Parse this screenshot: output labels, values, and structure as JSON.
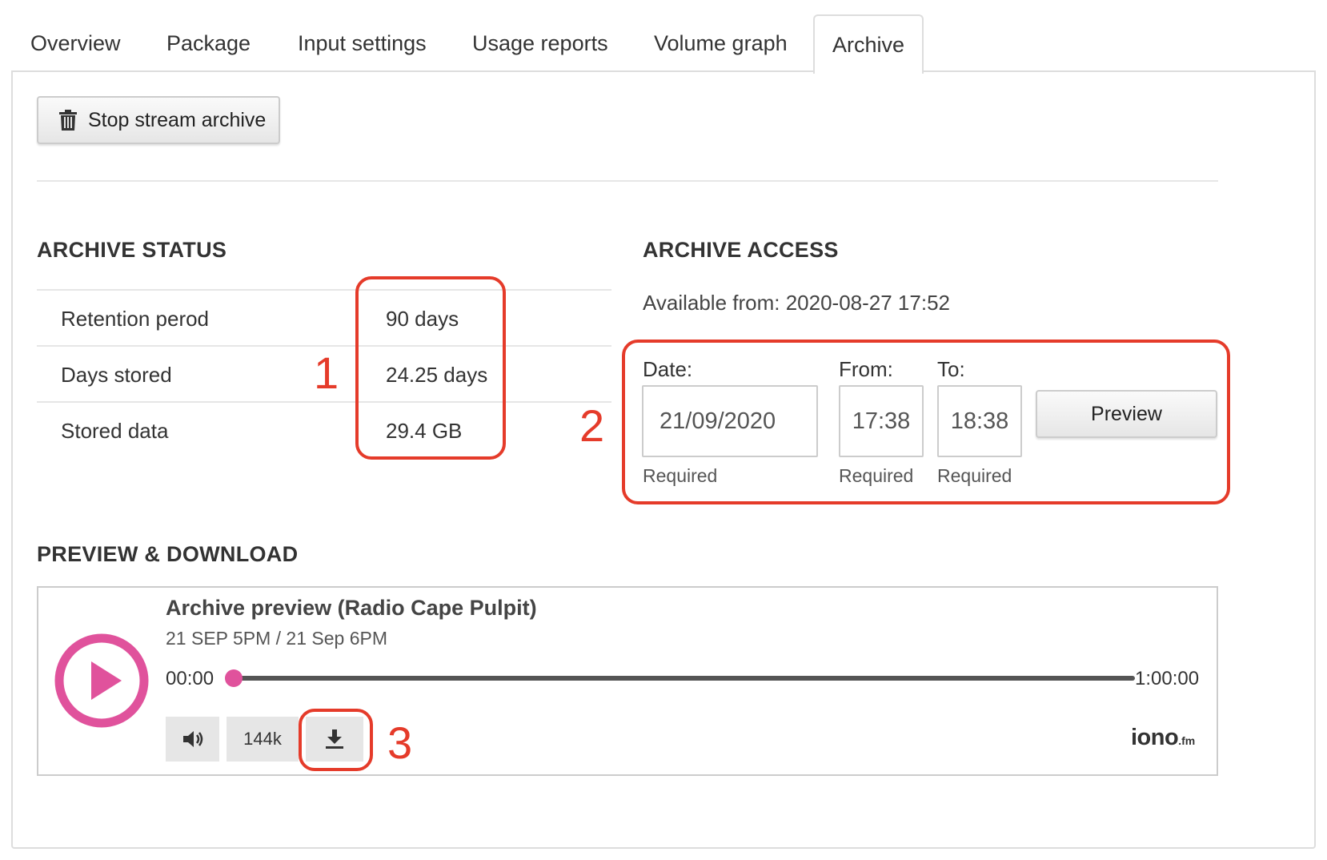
{
  "tabs": [
    {
      "label": "Overview"
    },
    {
      "label": "Package"
    },
    {
      "label": "Input settings"
    },
    {
      "label": "Usage reports"
    },
    {
      "label": "Volume graph"
    },
    {
      "label": "Archive"
    }
  ],
  "active_tab": "Archive",
  "toolbar": {
    "stop_label": "Stop stream archive",
    "stop_icon": "trash-icon"
  },
  "archive_status": {
    "heading": "ARCHIVE STATUS",
    "rows": [
      {
        "label": "Retention perod",
        "value": "90 days"
      },
      {
        "label": "Days stored",
        "value": "24.25 days"
      },
      {
        "label": "Stored data",
        "value": "29.4 GB"
      }
    ]
  },
  "archive_access": {
    "heading": "ARCHIVE ACCESS",
    "available_from": "Available from: 2020-08-27 17:52",
    "date_label": "Date:",
    "date_value": "21/09/2020",
    "from_label": "From:",
    "from_value": "17:38",
    "to_label": "To:",
    "to_value": "18:38",
    "required": "Required",
    "preview_label": "Preview"
  },
  "preview_download": {
    "heading": "PREVIEW & DOWNLOAD",
    "title": "Archive preview (Radio Cape Pulpit)",
    "subtitle": "21 SEP 5PM / 21 Sep 6PM",
    "current_time": "00:00",
    "duration": "1:00:00",
    "progress": 0,
    "bitrate": "144k",
    "brand": "iono",
    "brand_suffix": ".fm"
  },
  "annotations": [
    "1",
    "2",
    "3"
  ],
  "colors": {
    "accent": "#e0529c",
    "annotation": "#e53b2a"
  }
}
